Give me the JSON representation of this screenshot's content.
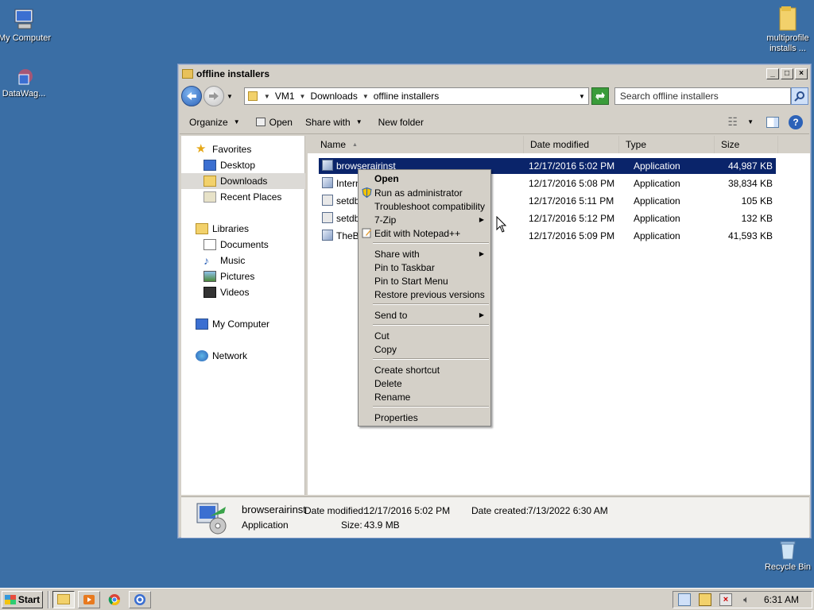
{
  "desktop": {
    "icons": {
      "my_computer": "My Computer",
      "datawag": "DataWag...",
      "multiprofile": "multiprofile installs ...",
      "recycle_bin": "Recycle Bin"
    }
  },
  "window": {
    "title": "offline installers",
    "address": {
      "crumbs": [
        "VM1",
        "Downloads",
        "offline installers"
      ]
    },
    "search": {
      "placeholder": "Search offline installers"
    },
    "toolbar": {
      "organize": "Organize",
      "open": "Open",
      "share_with": "Share with",
      "new_folder": "New folder"
    },
    "nav": {
      "favorites": "Favorites",
      "desktop": "Desktop",
      "downloads": "Downloads",
      "recent_places": "Recent Places",
      "libraries": "Libraries",
      "documents": "Documents",
      "music": "Music",
      "pictures": "Pictures",
      "videos": "Videos",
      "my_computer": "My Computer",
      "network": "Network"
    },
    "columns": {
      "name": "Name",
      "date_modified": "Date modified",
      "type": "Type",
      "size": "Size"
    },
    "files": [
      {
        "name": "browserairinst",
        "date": "12/17/2016 5:02 PM",
        "type": "Application",
        "size": "44,987 KB"
      },
      {
        "name": "Intern",
        "date": "12/17/2016 5:08 PM",
        "type": "Application",
        "size": "38,834 KB"
      },
      {
        "name": "setdb",
        "date": "12/17/2016 5:11 PM",
        "type": "Application",
        "size": "105 KB"
      },
      {
        "name": "setdb",
        "date": "12/17/2016 5:12 PM",
        "type": "Application",
        "size": "132 KB"
      },
      {
        "name": "TheBr",
        "date": "12/17/2016 5:09 PM",
        "type": "Application",
        "size": "41,593 KB"
      }
    ],
    "details": {
      "name": "browserairinst",
      "type": "Application",
      "date_modified_label": "Date modified:",
      "date_modified": "12/17/2016 5:02 PM",
      "date_created_label": "Date created:",
      "date_created": "7/13/2022 6:30 AM",
      "size_label": "Size:",
      "size": "43.9 MB"
    }
  },
  "context_menu": {
    "open": "Open",
    "run_as_admin": "Run as administrator",
    "troubleshoot": "Troubleshoot compatibility",
    "seven_zip": "7-Zip",
    "edit_notepad": "Edit with Notepad++",
    "share_with": "Share with",
    "pin_taskbar": "Pin to Taskbar",
    "pin_start": "Pin to Start Menu",
    "restore": "Restore previous versions",
    "send_to": "Send to",
    "cut": "Cut",
    "copy": "Copy",
    "create_shortcut": "Create shortcut",
    "delete": "Delete",
    "rename": "Rename",
    "properties": "Properties"
  },
  "taskbar": {
    "start": "Start",
    "clock": "6:31 AM"
  },
  "colors": {
    "desktop": "#3a6ea5",
    "selection": "#0a246a",
    "chrome": "#d4d0c8"
  }
}
